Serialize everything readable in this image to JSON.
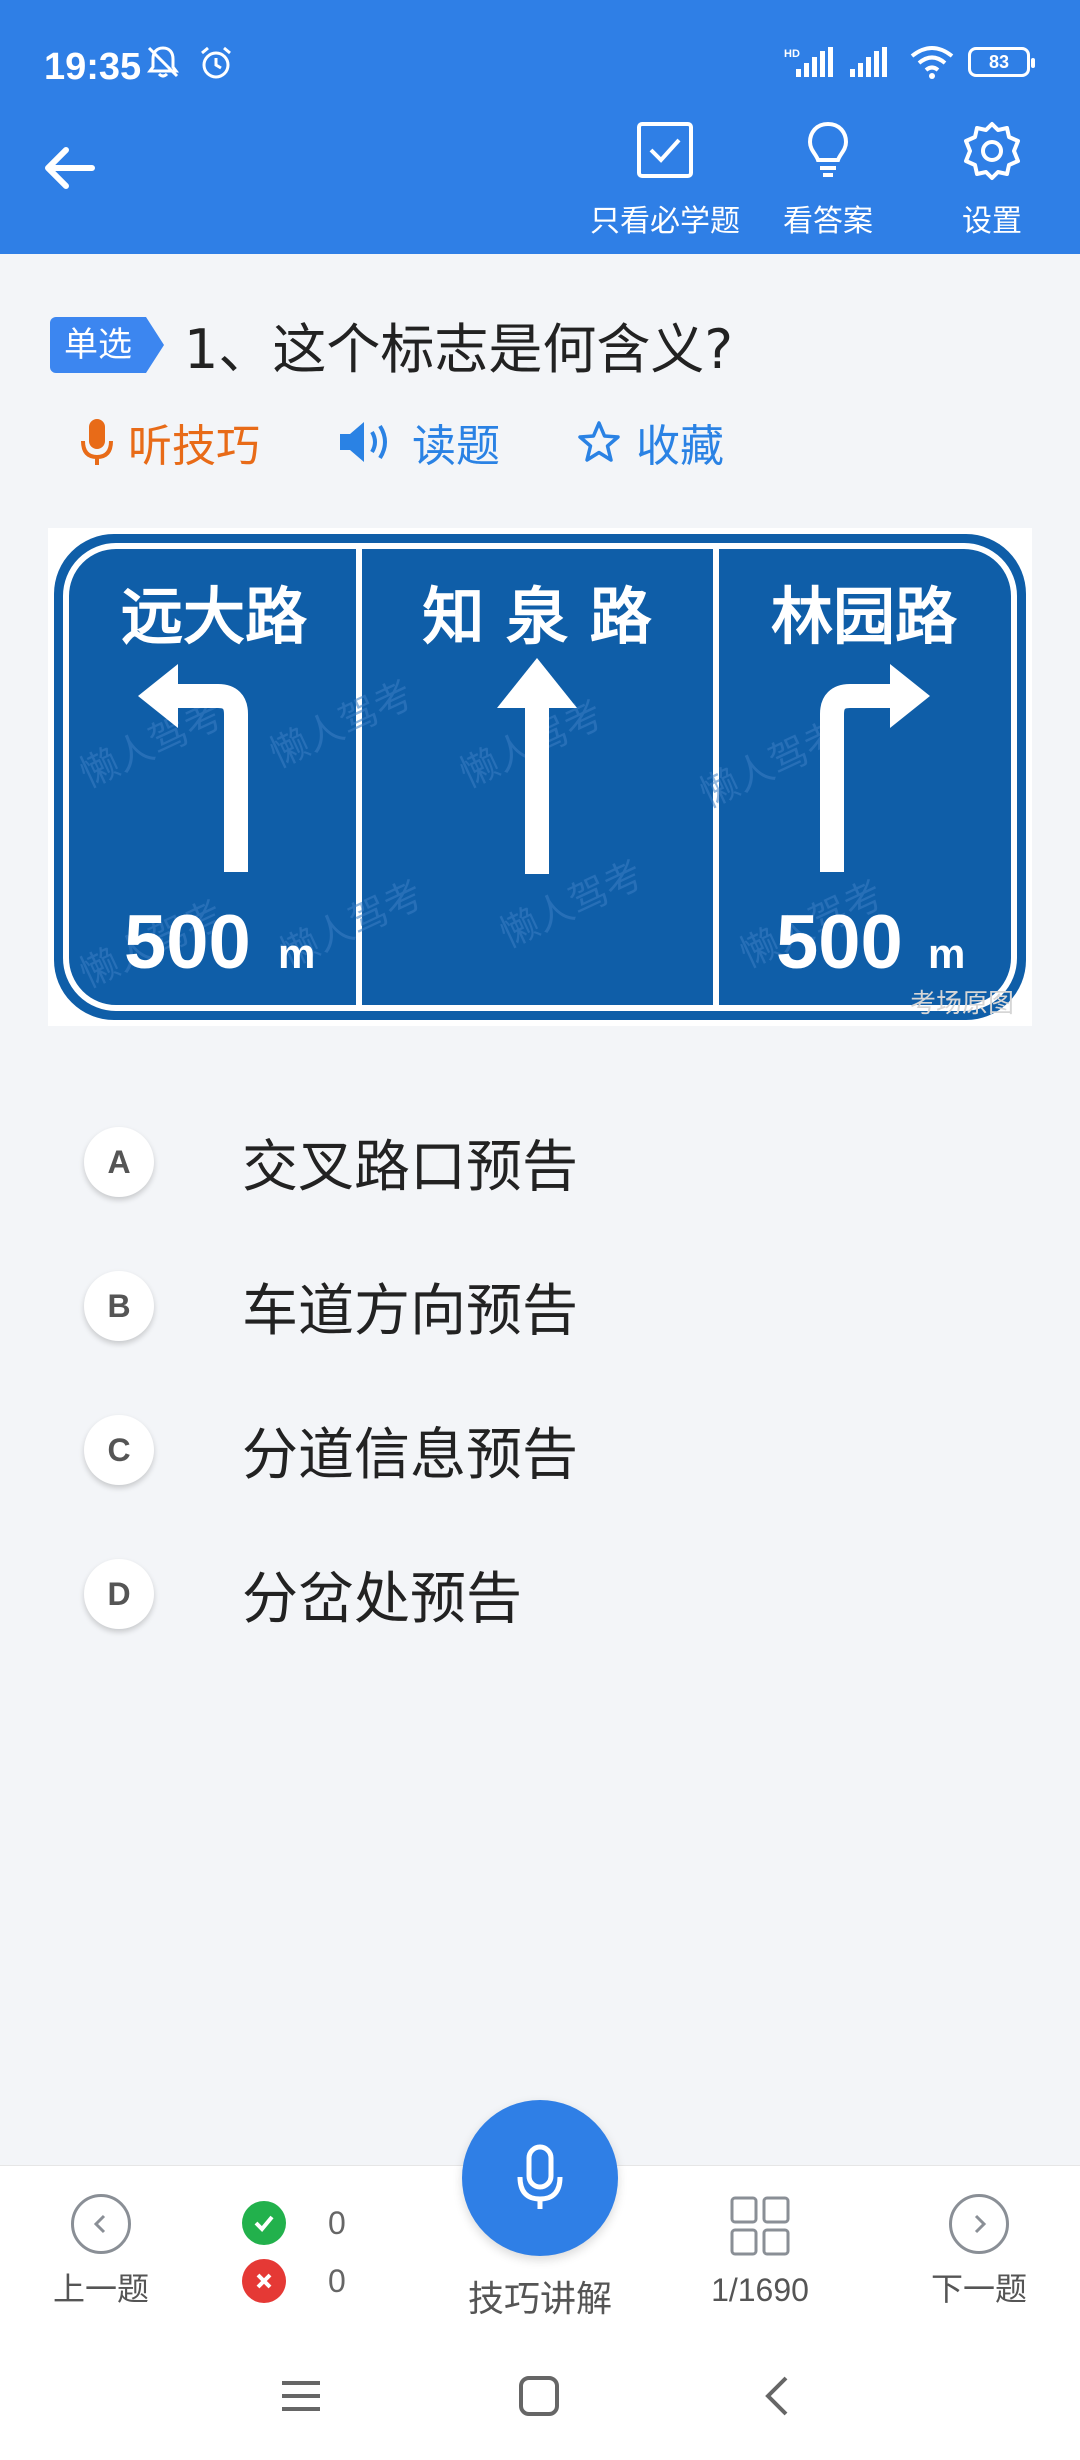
{
  "status": {
    "time": "19:35",
    "battery": "83",
    "signal_label": "HD"
  },
  "toolbar": {
    "must_study_label": "只看必学题",
    "answer_label": "看答案",
    "settings_label": "设置"
  },
  "question": {
    "type_badge": "单选",
    "text": "1、这个标志是何含义?",
    "actions": {
      "listen_tip": "听技巧",
      "read_question": "读题",
      "favorite": "收藏"
    }
  },
  "sign": {
    "left_road": "远大路",
    "center_road": "知 泉 路",
    "right_road": "林园路",
    "left_distance": "500",
    "right_distance": "500",
    "unit": "m",
    "caption": "考场原图",
    "watermark": "懒人驾考"
  },
  "options": [
    {
      "letter": "A",
      "text": "交叉路口预告"
    },
    {
      "letter": "B",
      "text": "车道方向预告"
    },
    {
      "letter": "C",
      "text": "分道信息预告"
    },
    {
      "letter": "D",
      "text": "分岔处预告"
    }
  ],
  "bottom": {
    "prev_label": "上一题",
    "correct_count": "0",
    "wrong_count": "0",
    "tip_label": "技巧讲解",
    "progress": "1/1690",
    "next_label": "下一题"
  },
  "colors": {
    "brand": "#2f7fe6",
    "sign_blue": "#0f5ea8",
    "listen_orange": "#e86b18"
  }
}
